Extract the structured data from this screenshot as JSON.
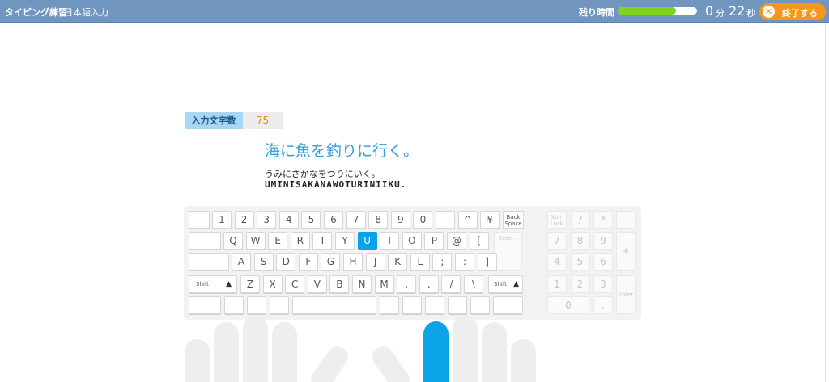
{
  "header": {
    "title": "タイピング練習",
    "subtitle": "日本語入力",
    "time_label": "残り時間",
    "time_progress": 0.73,
    "minutes": "0",
    "minutes_unit": "分",
    "seconds": "22",
    "seconds_unit": "秒",
    "end_label": "終了する",
    "end_icon": "x-icon"
  },
  "stats": {
    "count_label": "入力文字数",
    "count_value": "75"
  },
  "prompt": {
    "sentence": "海に魚を釣りに行く。",
    "kana": "うみにさかなをつりにいく。",
    "romaji": "UMINISAKANAWOTURINIIKU."
  },
  "keyboard": {
    "active_key": "U",
    "row1": [
      "1",
      "2",
      "3",
      "4",
      "5",
      "6",
      "7",
      "8",
      "9",
      "0",
      "-",
      "^",
      "¥"
    ],
    "row2": [
      "Q",
      "W",
      "E",
      "R",
      "T",
      "Y",
      "U",
      "I",
      "O",
      "P",
      "@",
      "["
    ],
    "row3": [
      "A",
      "S",
      "D",
      "F",
      "G",
      "H",
      "J",
      "K",
      "L",
      ";",
      ":",
      "]"
    ],
    "row4": [
      "Z",
      "X",
      "C",
      "V",
      "B",
      "N",
      "M",
      ",",
      ".",
      "/",
      "\\"
    ],
    "backspace": "Back Space",
    "enter": "Enter",
    "shift_left": "Shift",
    "shift_right": "Shift",
    "shift_icon": "arrow-up-icon",
    "numpad": {
      "numlock": "Num Lock",
      "slash": "/",
      "star": "*",
      "minus": "-",
      "plus": "+",
      "enter": "Enter",
      "row7": [
        "7",
        "8",
        "9"
      ],
      "row4": [
        "4",
        "5",
        "6"
      ],
      "row1": [
        "1",
        "2",
        "3"
      ],
      "zero": "0",
      "dot": "."
    }
  },
  "colors": {
    "header_bg": "#7096bf",
    "accent_blue": "#0aa3e7",
    "end_button": "#f7951d",
    "progress_green": "#7ed321"
  }
}
